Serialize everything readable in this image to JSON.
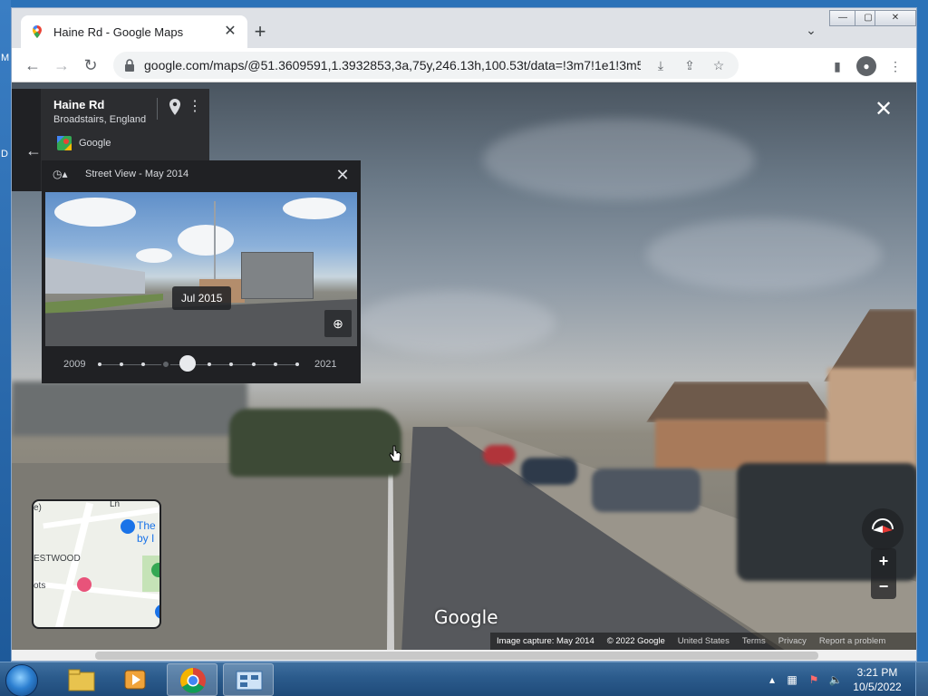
{
  "desktop": {
    "edge_letters": [
      "M",
      "D"
    ]
  },
  "browser": {
    "tab": {
      "title": "Haine Rd - Google Maps"
    },
    "window_controls": {
      "minimize": "—",
      "maximize": "▢",
      "close": "✕"
    },
    "url": "google.com/maps/@51.3609591,1.3932853,3a,75y,246.13h,100.53t/data=!3m7!1e1!3m5!1sx4gcjF-qTB..."
  },
  "street_view": {
    "place": {
      "street": "Haine Rd",
      "locality": "Broadstairs, England",
      "provider": "Google"
    },
    "time_machine": {
      "title": "Street View - May 2014",
      "thumbnail_date": "Jul 2015",
      "year_start": "2009",
      "year_end": "2021",
      "tick_count": 10,
      "selected_tick": 3,
      "knob_tick": 4
    },
    "minimap": {
      "labels": [
        "e)",
        "Ln",
        "The",
        "by I",
        "ESTWOOD",
        "ots"
      ]
    },
    "watermark": "Google",
    "footer": {
      "capture": "Image capture: May 2014",
      "copyright": "© 2022 Google",
      "country": "United States",
      "terms": "Terms",
      "privacy": "Privacy",
      "report": "Report a problem"
    },
    "zoom": {
      "in": "+",
      "out": "−"
    }
  },
  "taskbar": {
    "time": "3:21 PM",
    "date": "10/5/2022"
  },
  "colors": {
    "accent": "#1a73e8",
    "panel_bg": "#202124",
    "taskbar": "#2b5b8c"
  }
}
